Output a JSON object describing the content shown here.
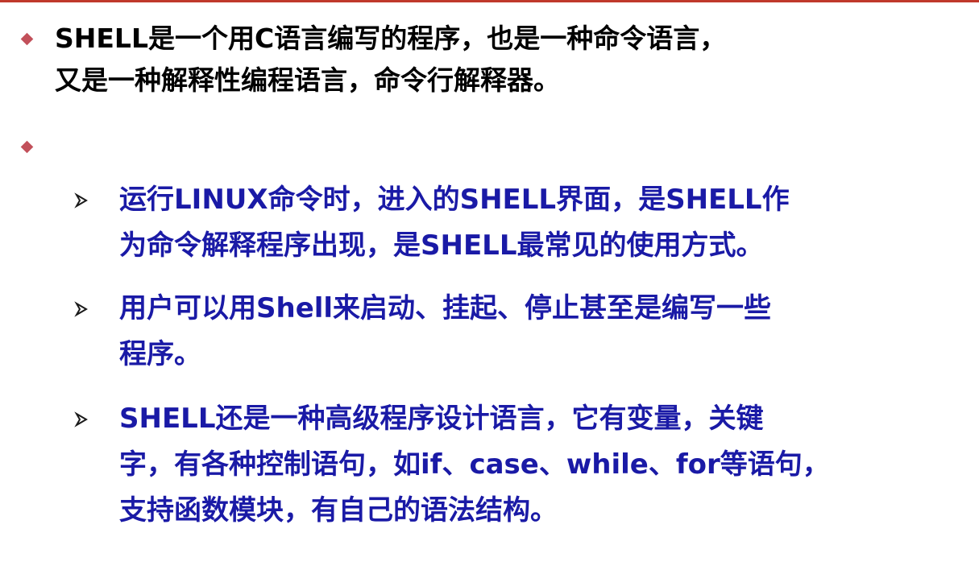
{
  "colors": {
    "bullet_diamond": "#c2505a",
    "level1_text": "#000000",
    "level2_text": "#1a1aa6",
    "arrow": "#1a1a1a",
    "top_rule": "#c0392b"
  },
  "bullets": [
    {
      "icon": "diamond-bullet-icon",
      "lines": [
        "SHELL是一个用C语言编写的程序，也是一种命令语言，",
        "又是一种解释性编程语言，命令行解释器。"
      ]
    },
    {
      "icon": "diamond-bullet-icon",
      "lines": []
    }
  ],
  "sub_bullets": [
    {
      "icon": "arrow-bullet-icon",
      "lines": [
        "运行LINUX命令时，进入的SHELL界面，是SHELL作",
        "为命令解释程序出现，是SHELL最常见的使用方式。"
      ]
    },
    {
      "icon": "arrow-bullet-icon",
      "lines": [
        "用户可以用Shell来启动、挂起、停止甚至是编写一些",
        "程序。"
      ]
    },
    {
      "icon": "arrow-bullet-icon",
      "lines": [
        "SHELL还是一种高级程序设计语言，它有变量，关键",
        "字，有各种控制语句，如if、case、while、for等语句，",
        "支持函数模块，有自己的语法结构。"
      ]
    }
  ]
}
